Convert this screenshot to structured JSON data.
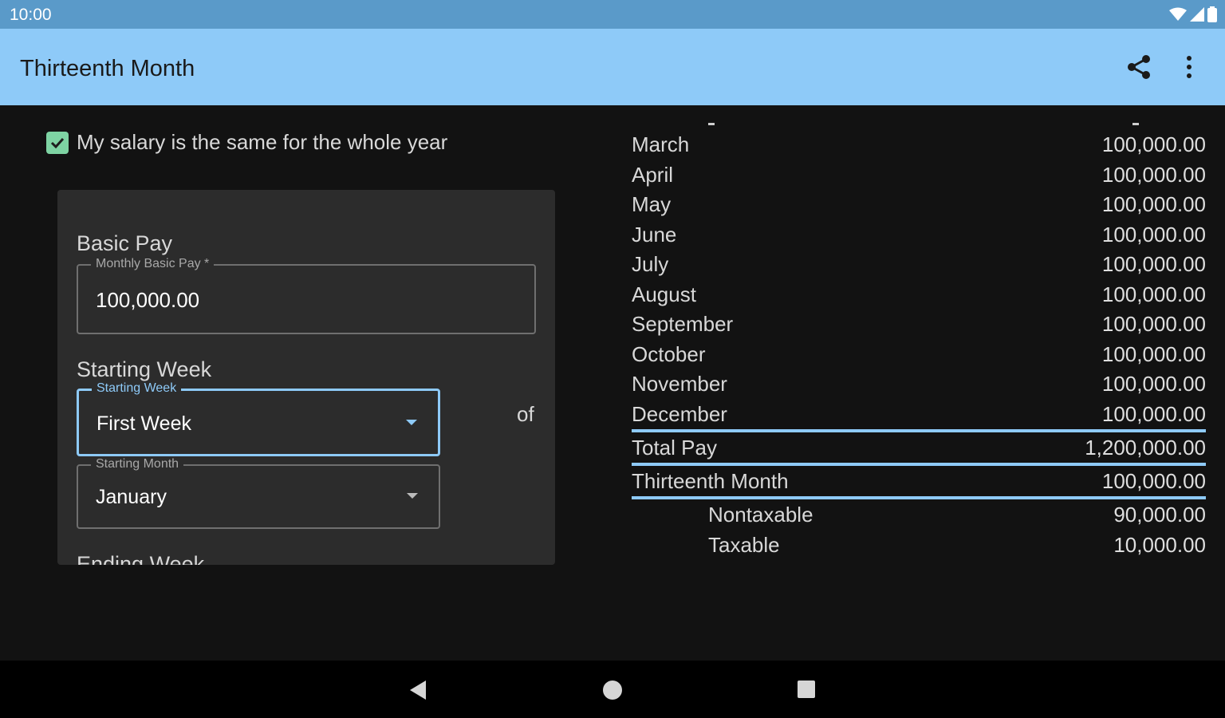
{
  "status_bar": {
    "time": "10:00"
  },
  "app_bar": {
    "title": "Thirteenth Month"
  },
  "same_salary": {
    "label": "My salary is the same for the whole year",
    "checked": true
  },
  "basic_pay": {
    "section_title": "Basic Pay",
    "field_label": "Monthly Basic Pay *",
    "value": "100,000.00"
  },
  "starting_week": {
    "section_title": "Starting Week",
    "week_label": "Starting Week",
    "week_value": "First Week",
    "of_label": "of",
    "month_label": "Starting Month",
    "month_value": "January"
  },
  "ending_week": {
    "section_title": "Ending Week"
  },
  "months": [
    {
      "name": "March",
      "amount": "100,000.00"
    },
    {
      "name": "April",
      "amount": "100,000.00"
    },
    {
      "name": "May",
      "amount": "100,000.00"
    },
    {
      "name": "June",
      "amount": "100,000.00"
    },
    {
      "name": "July",
      "amount": "100,000.00"
    },
    {
      "name": "August",
      "amount": "100,000.00"
    },
    {
      "name": "September",
      "amount": "100,000.00"
    },
    {
      "name": "October",
      "amount": "100,000.00"
    },
    {
      "name": "November",
      "amount": "100,000.00"
    },
    {
      "name": "December",
      "amount": "100,000.00"
    }
  ],
  "summary": {
    "total_pay_label": "Total Pay",
    "total_pay": "1,200,000.00",
    "thirteenth_label": "Thirteenth Month",
    "thirteenth": "100,000.00",
    "nontaxable_label": "Nontaxable",
    "nontaxable": "90,000.00",
    "taxable_label": "Taxable",
    "taxable": "10,000.00"
  },
  "colors": {
    "accent": "#8ecaf8",
    "status_bar": "#5a9ac9",
    "checkbox": "#7ed3a3",
    "background": "#121212",
    "card": "#2c2c2c"
  }
}
